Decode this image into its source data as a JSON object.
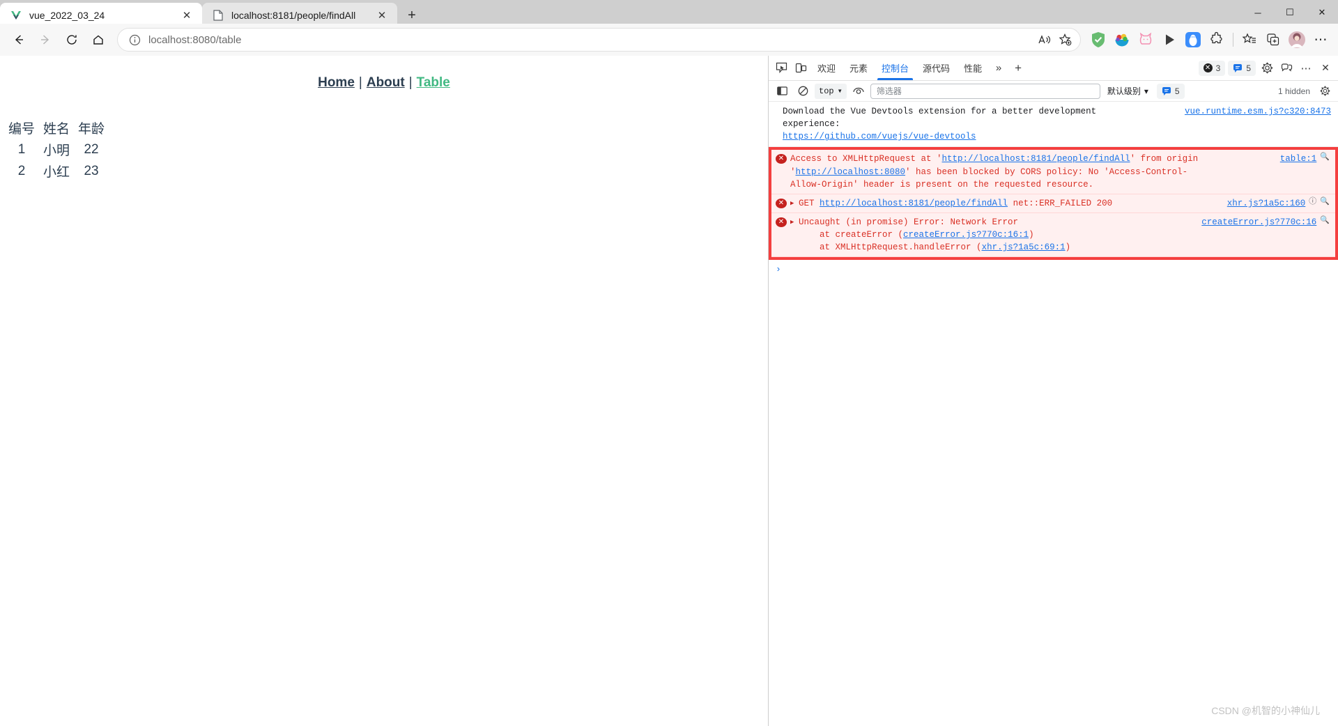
{
  "browser": {
    "tabs": [
      {
        "title": "vue_2022_03_24",
        "favicon": "vue-logo-icon",
        "active": true,
        "close_label": "✕"
      },
      {
        "title": "localhost:8181/people/findAll",
        "favicon": "page-icon",
        "active": false,
        "close_label": "✕"
      }
    ],
    "new_tab_label": "+",
    "window_controls": {
      "minimize": "─",
      "maximize": "☐",
      "close": "✕"
    },
    "nav": {
      "back": "←",
      "forward": "→",
      "refresh": "⟳",
      "home": "⌂"
    },
    "omnibox": {
      "info_icon": "info-circle-icon",
      "url_host": "localhost",
      "url_path": ":8080/table",
      "url_full": "localhost:8080/table",
      "read_aloud_label": "A",
      "favorite_label": "☆"
    },
    "extensions": [
      {
        "name": "adguard-shield-icon",
        "color": "#68bc71"
      },
      {
        "name": "colorful-bowl-icon",
        "color": "#e8b93a"
      },
      {
        "name": "pink-cat-icon",
        "color": "#f7a8c0"
      },
      {
        "name": "play-button-icon",
        "color": "#3c3c3c"
      },
      {
        "name": "blue-penguin-icon",
        "color": "#3b8dfb"
      },
      {
        "name": "puzzle-extensions-icon",
        "color": "#3c3c3c"
      }
    ],
    "toolbar_right": {
      "favorites": "favorites-list-icon",
      "collections": "collections-icon",
      "profile": "avatar-icon",
      "settings_more": "⋯"
    }
  },
  "page": {
    "nav_links": [
      {
        "label": "Home",
        "active": false
      },
      {
        "label": "About",
        "active": false
      },
      {
        "label": "Table",
        "active": true
      }
    ],
    "nav_separator": "|",
    "table": {
      "headers": [
        "编号",
        "姓名",
        "年龄"
      ],
      "rows": [
        [
          "1",
          "小明",
          "22"
        ],
        [
          "2",
          "小红",
          "23"
        ]
      ]
    }
  },
  "devtools": {
    "inspect_icon": "inspect-element-icon",
    "device_icon": "device-toolbar-icon",
    "tabs": [
      {
        "label": "欢迎",
        "active": false
      },
      {
        "label": "元素",
        "active": false
      },
      {
        "label": "控制台",
        "active": true
      },
      {
        "label": "源代码",
        "active": false
      },
      {
        "label": "性能",
        "active": false
      }
    ],
    "more_tabs_label": "»",
    "add_tab_label": "+",
    "error_badge": {
      "count": "3",
      "icon": "error-circle-icon"
    },
    "message_badge": {
      "count": "5",
      "icon": "message-bubble-icon"
    },
    "settings_icon": "gear-icon",
    "feedback_icon": "feedback-icon",
    "more_icon": "⋯",
    "close_icon": "✕",
    "console_toolbar": {
      "sidebar_icon": "console-sidebar-icon",
      "clear_icon": "clear-console-icon",
      "context_value": "top",
      "context_caret": "▾",
      "eye_icon": "live-expression-icon",
      "filter_placeholder": "筛选器",
      "level_value": "默认级别",
      "level_caret": "▾",
      "message_count": "5",
      "hidden_label": "1 hidden",
      "settings_icon": "gear-icon"
    },
    "messages": [
      {
        "type": "info",
        "text": "Download the Vue Devtools extension for a better development\nexperience:\n",
        "link": "https://github.com/vuejs/vue-devtools",
        "source": "vue.runtime.esm.js?c320:8473"
      }
    ],
    "errors": [
      {
        "segments": [
          {
            "t": "Access to XMLHttpRequest at '",
            "link": false
          },
          {
            "t": "http://localhost:8181/people/findAll",
            "link": true
          },
          {
            "t": "' from origin\n'",
            "link": false
          },
          {
            "t": "http://localhost:8080",
            "link": true
          },
          {
            "t": "' has been blocked by CORS policy: No 'Access-Control-\nAllow-Origin' header is present on the requested resource.",
            "link": false
          }
        ],
        "source": "table:1",
        "has_triangle": false,
        "has_info_icon": false
      },
      {
        "segments": [
          {
            "t": "GET ",
            "link": false
          },
          {
            "t": "http://localhost:8181/people/findAll",
            "link": true
          },
          {
            "t": " net::ERR_FAILED 200",
            "link": false
          }
        ],
        "source": "xhr.js?1a5c:160",
        "has_triangle": true,
        "has_info_icon": true
      },
      {
        "segments": [
          {
            "t": "Uncaught (in promise) Error: Network Error\n    at createError (",
            "link": false
          },
          {
            "t": "createError.js?770c:16:1",
            "link": true
          },
          {
            "t": ")\n    at XMLHttpRequest.handleError (",
            "link": false
          },
          {
            "t": "xhr.js?1a5c:69:1",
            "link": true
          },
          {
            "t": ")",
            "link": false
          }
        ],
        "source": "createError.js?770c:16",
        "has_triangle": true,
        "has_info_icon": false
      }
    ],
    "prompt_symbol": "›"
  },
  "watermark": "CSDN @机智的小神仙儿",
  "colors": {
    "accent_blue": "#1a73e8",
    "error_red": "#c5221f",
    "error_border": "#f43f3f",
    "vue_green": "#42b983",
    "page_text": "#2c3e50"
  }
}
